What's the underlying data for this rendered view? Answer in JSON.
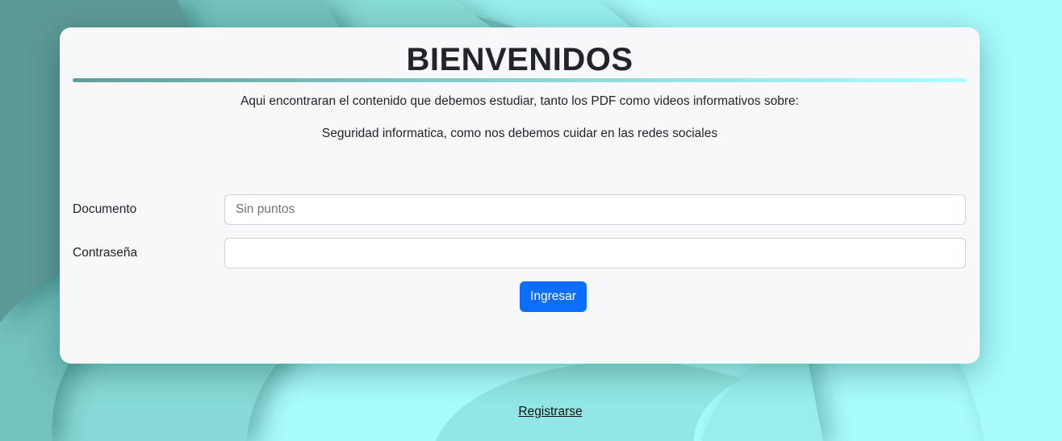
{
  "colors": {
    "card_background": "#f7f8fa",
    "accent_button": "#0d6efd",
    "background_light": "#a8fbfb",
    "background_dark": "#5c9a97"
  },
  "card": {
    "title": "BIENVENIDOS",
    "intro_line_1": "Aqui encontraran el contenido que debemos estudiar, tanto los PDF como videos informativos sobre:",
    "intro_line_2": "Seguridad informatica, como nos debemos cuidar en las redes sociales"
  },
  "form": {
    "document_label": "Documento",
    "document_value": "",
    "document_placeholder": "Sin puntos",
    "password_label": "Contraseña",
    "password_value": "",
    "submit_label": "Ingresar"
  },
  "footer": {
    "register_link": "Registrarse"
  }
}
